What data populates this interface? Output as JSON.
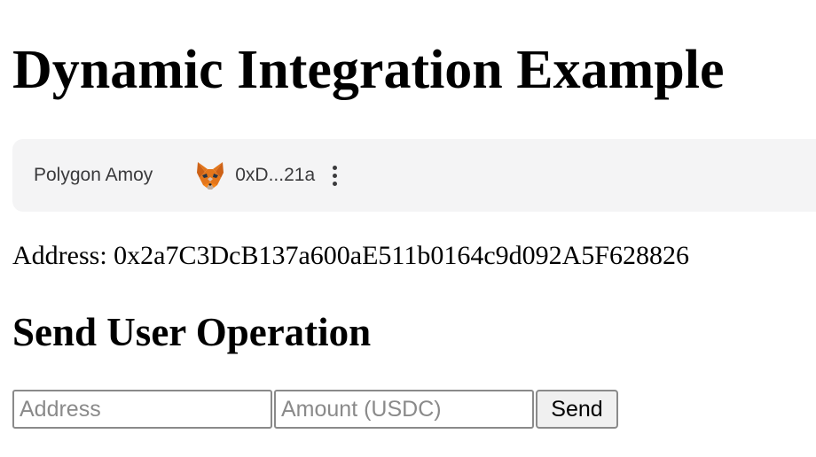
{
  "page": {
    "title": "Dynamic Integration Example"
  },
  "wallet_widget": {
    "network": "Polygon Amoy",
    "account_short": "0xD...21a",
    "wallet_icon": "metamask-fox-icon",
    "menu_icon": "more-vertical-icon",
    "background_color": "#f4f4f5"
  },
  "address_line": {
    "text": "Address: 0x2a7C3DcB137a600aE511b0164c9d092A5F628826"
  },
  "send_section": {
    "title": "Send User Operation",
    "address_input": {
      "value": "",
      "placeholder": "Address"
    },
    "amount_input": {
      "value": "",
      "placeholder": "Amount (USDC)"
    },
    "send_label": "Send"
  }
}
